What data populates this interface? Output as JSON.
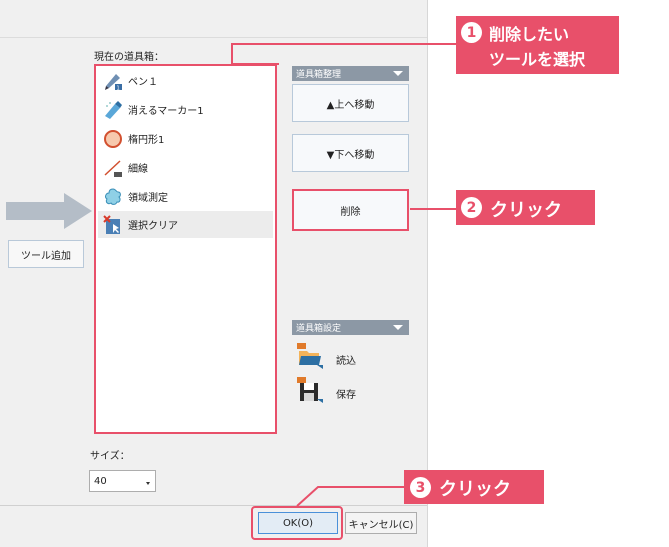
{
  "dialog": {
    "toolbox_label": "現在の道具箱：",
    "add_tool_button": "ツール追加",
    "tools": [
      {
        "label": "ペン１",
        "icon": "pen-icon"
      },
      {
        "label": "消えるマーカー1",
        "icon": "vanishing-marker-icon"
      },
      {
        "label": "楕円形1",
        "icon": "ellipse-icon"
      },
      {
        "label": "細線",
        "icon": "thin-line-icon"
      },
      {
        "label": "領域測定",
        "icon": "area-measure-icon"
      },
      {
        "label": "選択クリア",
        "icon": "clear-selection-icon",
        "selected": true
      }
    ],
    "organize_header": "道具箱整理",
    "move_up_button": "▲上へ移動",
    "move_down_button": "▼下へ移動",
    "delete_button": "削除",
    "settings_header": "道具箱設定",
    "load_label": "読込",
    "save_label": "保存",
    "size_label": "サイズ：",
    "size_value": "40",
    "ok_button": "OK(O)",
    "cancel_button": "キャンセル(C)"
  },
  "callouts": {
    "step1_number": "1",
    "step1_line1": "削除したい",
    "step1_line2": "ツールを選択",
    "step2_number": "2",
    "step2_text": "クリック",
    "step3_number": "3",
    "step3_text": "クリック"
  },
  "colors": {
    "accent": "#e8506a",
    "section_header": "#8c98a5",
    "ok_border": "#4a90d9"
  }
}
